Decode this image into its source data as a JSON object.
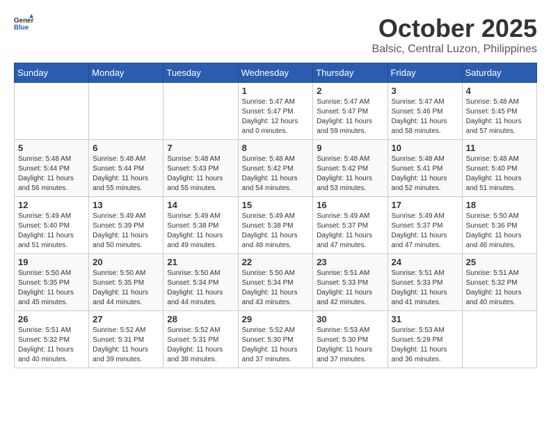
{
  "logo": {
    "text_general": "General",
    "text_blue": "Blue"
  },
  "title": {
    "month": "October 2025",
    "location": "Balsic, Central Luzon, Philippines"
  },
  "days_of_week": [
    "Sunday",
    "Monday",
    "Tuesday",
    "Wednesday",
    "Thursday",
    "Friday",
    "Saturday"
  ],
  "weeks": [
    [
      {
        "day": "",
        "info": ""
      },
      {
        "day": "",
        "info": ""
      },
      {
        "day": "",
        "info": ""
      },
      {
        "day": "1",
        "info": "Sunrise: 5:47 AM\nSunset: 5:47 PM\nDaylight: 12 hours\nand 0 minutes."
      },
      {
        "day": "2",
        "info": "Sunrise: 5:47 AM\nSunset: 5:47 PM\nDaylight: 11 hours\nand 59 minutes."
      },
      {
        "day": "3",
        "info": "Sunrise: 5:47 AM\nSunset: 5:46 PM\nDaylight: 11 hours\nand 58 minutes."
      },
      {
        "day": "4",
        "info": "Sunrise: 5:48 AM\nSunset: 5:45 PM\nDaylight: 11 hours\nand 57 minutes."
      }
    ],
    [
      {
        "day": "5",
        "info": "Sunrise: 5:48 AM\nSunset: 5:44 PM\nDaylight: 11 hours\nand 56 minutes."
      },
      {
        "day": "6",
        "info": "Sunrise: 5:48 AM\nSunset: 5:44 PM\nDaylight: 11 hours\nand 55 minutes."
      },
      {
        "day": "7",
        "info": "Sunrise: 5:48 AM\nSunset: 5:43 PM\nDaylight: 11 hours\nand 55 minutes."
      },
      {
        "day": "8",
        "info": "Sunrise: 5:48 AM\nSunset: 5:42 PM\nDaylight: 11 hours\nand 54 minutes."
      },
      {
        "day": "9",
        "info": "Sunrise: 5:48 AM\nSunset: 5:42 PM\nDaylight: 11 hours\nand 53 minutes."
      },
      {
        "day": "10",
        "info": "Sunrise: 5:48 AM\nSunset: 5:41 PM\nDaylight: 11 hours\nand 52 minutes."
      },
      {
        "day": "11",
        "info": "Sunrise: 5:48 AM\nSunset: 5:40 PM\nDaylight: 11 hours\nand 51 minutes."
      }
    ],
    [
      {
        "day": "12",
        "info": "Sunrise: 5:49 AM\nSunset: 5:40 PM\nDaylight: 11 hours\nand 51 minutes."
      },
      {
        "day": "13",
        "info": "Sunrise: 5:49 AM\nSunset: 5:39 PM\nDaylight: 11 hours\nand 50 minutes."
      },
      {
        "day": "14",
        "info": "Sunrise: 5:49 AM\nSunset: 5:38 PM\nDaylight: 11 hours\nand 49 minutes."
      },
      {
        "day": "15",
        "info": "Sunrise: 5:49 AM\nSunset: 5:38 PM\nDaylight: 11 hours\nand 48 minutes."
      },
      {
        "day": "16",
        "info": "Sunrise: 5:49 AM\nSunset: 5:37 PM\nDaylight: 11 hours\nand 47 minutes."
      },
      {
        "day": "17",
        "info": "Sunrise: 5:49 AM\nSunset: 5:37 PM\nDaylight: 11 hours\nand 47 minutes."
      },
      {
        "day": "18",
        "info": "Sunrise: 5:50 AM\nSunset: 5:36 PM\nDaylight: 11 hours\nand 46 minutes."
      }
    ],
    [
      {
        "day": "19",
        "info": "Sunrise: 5:50 AM\nSunset: 5:35 PM\nDaylight: 11 hours\nand 45 minutes."
      },
      {
        "day": "20",
        "info": "Sunrise: 5:50 AM\nSunset: 5:35 PM\nDaylight: 11 hours\nand 44 minutes."
      },
      {
        "day": "21",
        "info": "Sunrise: 5:50 AM\nSunset: 5:34 PM\nDaylight: 11 hours\nand 44 minutes."
      },
      {
        "day": "22",
        "info": "Sunrise: 5:50 AM\nSunset: 5:34 PM\nDaylight: 11 hours\nand 43 minutes."
      },
      {
        "day": "23",
        "info": "Sunrise: 5:51 AM\nSunset: 5:33 PM\nDaylight: 11 hours\nand 42 minutes."
      },
      {
        "day": "24",
        "info": "Sunrise: 5:51 AM\nSunset: 5:33 PM\nDaylight: 11 hours\nand 41 minutes."
      },
      {
        "day": "25",
        "info": "Sunrise: 5:51 AM\nSunset: 5:32 PM\nDaylight: 11 hours\nand 40 minutes."
      }
    ],
    [
      {
        "day": "26",
        "info": "Sunrise: 5:51 AM\nSunset: 5:32 PM\nDaylight: 11 hours\nand 40 minutes."
      },
      {
        "day": "27",
        "info": "Sunrise: 5:52 AM\nSunset: 5:31 PM\nDaylight: 11 hours\nand 39 minutes."
      },
      {
        "day": "28",
        "info": "Sunrise: 5:52 AM\nSunset: 5:31 PM\nDaylight: 11 hours\nand 38 minutes."
      },
      {
        "day": "29",
        "info": "Sunrise: 5:52 AM\nSunset: 5:30 PM\nDaylight: 11 hours\nand 37 minutes."
      },
      {
        "day": "30",
        "info": "Sunrise: 5:53 AM\nSunset: 5:30 PM\nDaylight: 11 hours\nand 37 minutes."
      },
      {
        "day": "31",
        "info": "Sunrise: 5:53 AM\nSunset: 5:29 PM\nDaylight: 11 hours\nand 36 minutes."
      },
      {
        "day": "",
        "info": ""
      }
    ]
  ]
}
